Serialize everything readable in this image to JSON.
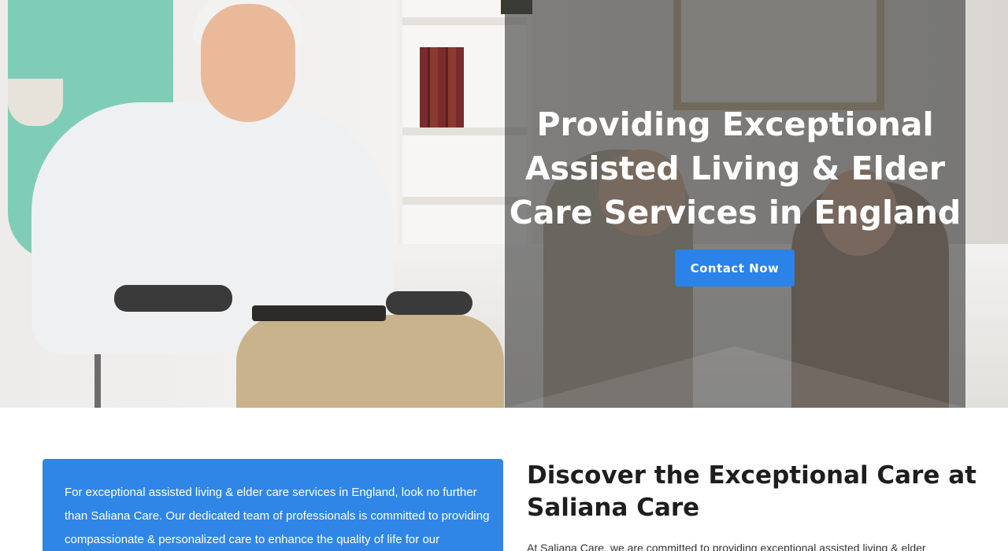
{
  "hero": {
    "title": "Providing Exceptional Assisted Living & Elder Care Services in England",
    "cta_label": "Contact Now",
    "overlay_color": "#3c3c3c",
    "cta_color": "#2b82e8"
  },
  "intro": {
    "text": "For exceptional assisted living & elder care services in England, look no further than Saliana Care. Our dedicated team of professionals is committed to providing compassionate & personalized care to enhance the quality of life for our",
    "card_color": "#2f86e6"
  },
  "discover": {
    "title": "Discover the Exceptional Care at Saliana Care",
    "text": "At Saliana Care, we are committed to providing exceptional assisted living & elder"
  }
}
